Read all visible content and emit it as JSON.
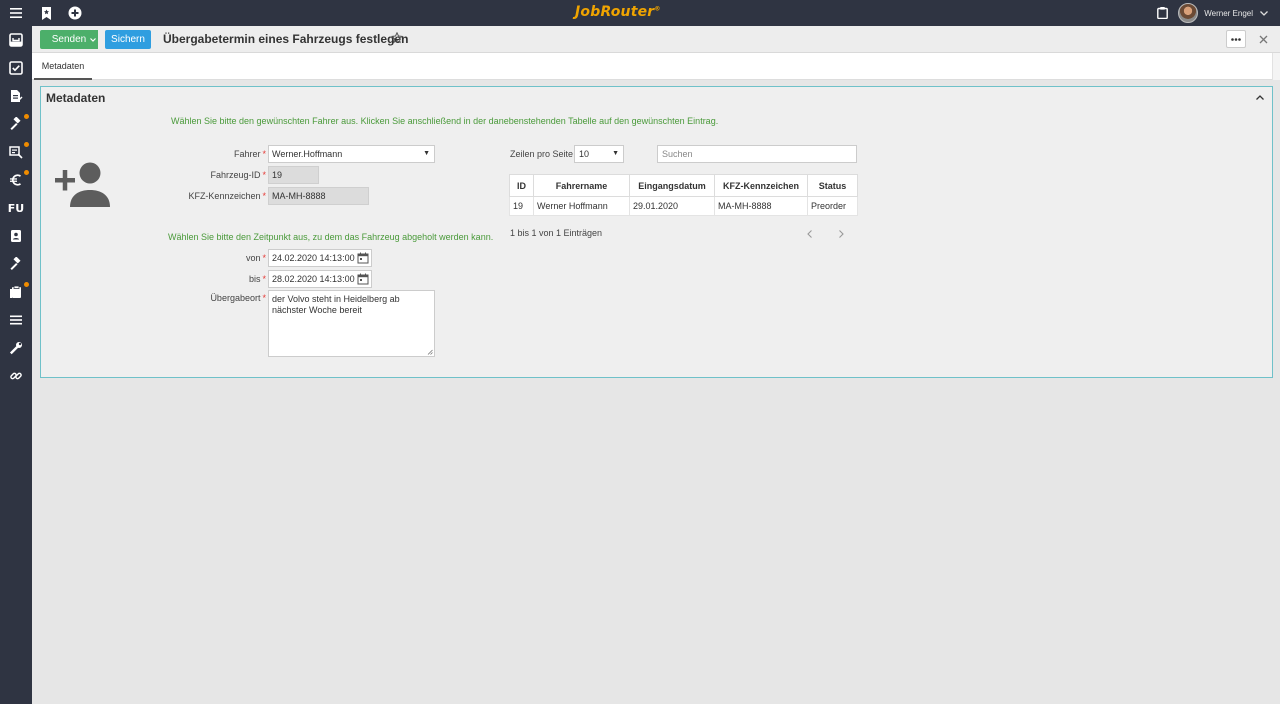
{
  "brand": {
    "name": "JobRouter",
    "mark": "®"
  },
  "user": {
    "name": "Werner Engel"
  },
  "toolbar": {
    "send_label": "Senden",
    "save_label": "Sichern"
  },
  "page": {
    "title": "Übergabetermin eines Fahrzeugs festlegen"
  },
  "tabs": [
    {
      "label": "Metadaten",
      "active": true
    }
  ],
  "panel": {
    "title": "Metadaten",
    "hint_driver": "Wählen Sie bitte den gewünschten Fahrer aus. Klicken Sie anschließend in der danebenstehenden Tabelle auf den gewünschten Eintrag.",
    "hint_time": "Wählen Sie bitte den Zeitpunkt aus, zu dem das Fahrzeug abgeholt werden kann.",
    "fields": {
      "fahrer": {
        "label": "Fahrer",
        "value": "Werner.Hoffmann"
      },
      "fahrzeug_id": {
        "label": "Fahrzeug-ID",
        "value": "19"
      },
      "kfz": {
        "label": "KFZ-Kennzeichen",
        "value": "MA-MH-8888"
      },
      "von": {
        "label": "von",
        "value": "24.02.2020 14:13:00"
      },
      "bis": {
        "label": "bis",
        "value": "28.02.2020 14:13:00"
      },
      "ort": {
        "label": "Übergabeort",
        "value": "der Volvo steht in Heidelberg ab nächster Woche bereit"
      }
    },
    "table": {
      "rows_per_page_label": "Zeilen pro Seite",
      "rows_per_page_value": "10",
      "search_placeholder": "Suchen",
      "columns": [
        "ID",
        "Fahrername",
        "Eingangsdatum",
        "KFZ-Kennzeichen",
        "Status"
      ],
      "rows": [
        [
          "19",
          "Werner Hoffmann",
          "29.01.2020",
          "MA-MH-8888",
          "Preorder"
        ]
      ],
      "info": "1 bis 1 von 1 Einträgen"
    }
  },
  "colors": {
    "sidebar": "#2f3442",
    "send": "#4caf6a",
    "save": "#2f9ee0",
    "hint": "#4a9a3a",
    "badge": "#f08c00",
    "brand": "#f0a400",
    "panel_border": "#6fc1c9"
  },
  "sidebar_items": [
    {
      "icon": "inbox-icon",
      "badge": false
    },
    {
      "icon": "checkbox-icon",
      "badge": false
    },
    {
      "icon": "document-edit-icon",
      "badge": false
    },
    {
      "icon": "hammer-icon",
      "badge": true
    },
    {
      "icon": "cart-icon",
      "badge": true
    },
    {
      "icon": "euro-icon",
      "badge": true
    },
    {
      "icon": "fu-text-icon",
      "text": "FU",
      "badge": false
    },
    {
      "icon": "contact-card-icon",
      "badge": false
    },
    {
      "icon": "hammer-icon",
      "badge": false
    },
    {
      "icon": "clipboard-icon",
      "badge": true
    },
    {
      "icon": "list-icon",
      "badge": false
    },
    {
      "icon": "wrench-icon",
      "badge": false
    },
    {
      "icon": "link-icon",
      "badge": false
    }
  ]
}
